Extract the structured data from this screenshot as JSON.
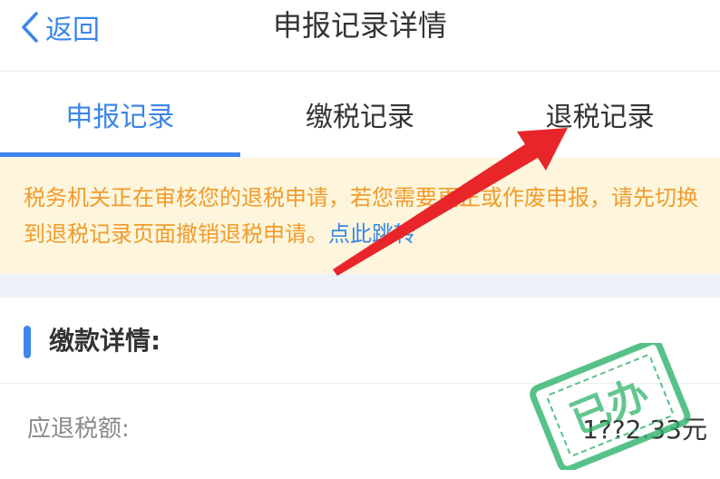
{
  "header": {
    "back_label": "返回",
    "title": "申报记录详情"
  },
  "tabs": [
    {
      "label": "申报记录",
      "active": true
    },
    {
      "label": "缴税记录",
      "active": false
    },
    {
      "label": "退税记录",
      "active": false
    }
  ],
  "notice": {
    "text": "税务机关正在审核您的退税申请，若您需要更正或作废申报，请先切换到退税记录页面撤销退税申请。",
    "link": "点此跳转"
  },
  "section": {
    "title": "缴款详情:",
    "rows": [
      {
        "label": "应退税额:",
        "value": "1??2.33元"
      }
    ]
  },
  "stamp": {
    "text": "已办"
  },
  "colors": {
    "accent": "#3b86e8",
    "notice_text": "#f19b2c",
    "notice_bg": "#fdf6dd",
    "stamp": "#2db36a",
    "annotation_arrow": "#e8262a"
  }
}
